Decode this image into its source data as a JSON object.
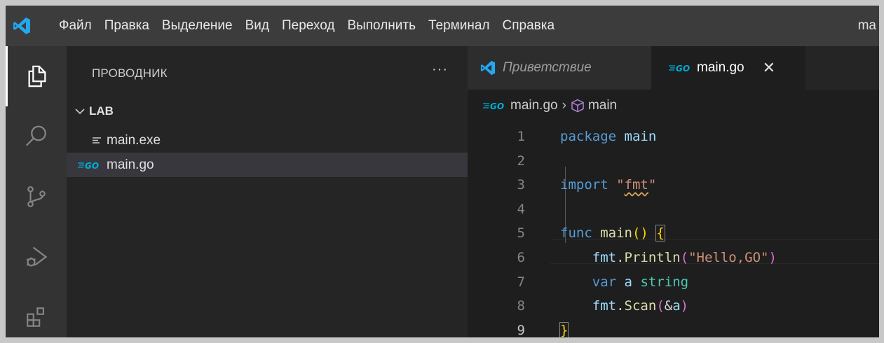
{
  "menubar": {
    "items": [
      "Файл",
      "Правка",
      "Выделение",
      "Вид",
      "Переход",
      "Выполнить",
      "Терминал",
      "Справка"
    ],
    "title_fragment": "ma"
  },
  "activity_bar": {
    "icons": [
      "explorer-icon",
      "search-icon",
      "source-control-icon",
      "run-debug-icon",
      "extensions-icon"
    ]
  },
  "sidebar": {
    "title": "ПРОВОДНИК",
    "more": "···",
    "folder": "LAB",
    "files": [
      {
        "name": "main.exe",
        "icon": "lines-icon"
      },
      {
        "name": "main.go",
        "icon": "go-icon",
        "selected": true
      }
    ]
  },
  "editor": {
    "tabs": [
      {
        "label": "Приветствие",
        "active": false,
        "icon": "vscode-icon"
      },
      {
        "label": "main.go",
        "active": true,
        "icon": "go-icon",
        "close": "✕"
      }
    ],
    "breadcrumb": {
      "file": "main.go",
      "separator": "›",
      "symbol": "main"
    },
    "lines": [
      {
        "n": "1",
        "tokens": [
          [
            "kw",
            "package"
          ],
          [
            "plain",
            " "
          ],
          [
            "var",
            "main"
          ]
        ]
      },
      {
        "n": "2",
        "tokens": []
      },
      {
        "n": "3",
        "tokens": [
          [
            "kw",
            "import"
          ],
          [
            "plain",
            " "
          ],
          [
            "str",
            "\""
          ],
          [
            "strsq",
            "fmt"
          ],
          [
            "str",
            "\""
          ]
        ]
      },
      {
        "n": "4",
        "tokens": []
      },
      {
        "n": "5",
        "tokens": [
          [
            "kw",
            "func"
          ],
          [
            "plain",
            " "
          ],
          [
            "fn",
            "main"
          ],
          [
            "br1",
            "()"
          ],
          [
            "plain",
            " "
          ],
          [
            "br1m",
            "{"
          ]
        ]
      },
      {
        "n": "6",
        "tokens": [
          [
            "plain",
            "    "
          ],
          [
            "var",
            "fmt"
          ],
          [
            "plain",
            "."
          ],
          [
            "fn",
            "Println"
          ],
          [
            "br2",
            "("
          ],
          [
            "str",
            "\"Hello,GO\""
          ],
          [
            "br2",
            ")"
          ]
        ]
      },
      {
        "n": "7",
        "tokens": [
          [
            "plain",
            "    "
          ],
          [
            "kw",
            "var"
          ],
          [
            "plain",
            " "
          ],
          [
            "var",
            "a"
          ],
          [
            "plain",
            " "
          ],
          [
            "ty",
            "string"
          ]
        ]
      },
      {
        "n": "8",
        "tokens": [
          [
            "plain",
            "    "
          ],
          [
            "var",
            "fmt"
          ],
          [
            "plain",
            "."
          ],
          [
            "fn",
            "Scan"
          ],
          [
            "br2",
            "("
          ],
          [
            "plain",
            "&"
          ],
          [
            "var",
            "a"
          ],
          [
            "br2",
            ")"
          ]
        ]
      },
      {
        "n": "9",
        "tokens": [
          [
            "br1m",
            "}"
          ]
        ]
      }
    ],
    "current_line": "9"
  },
  "colors": {
    "titlebar": "#3c3c3c",
    "activitybar": "#333333",
    "sidebar": "#252526",
    "editor": "#1e1e1e",
    "accent": "#0078d4",
    "go_blue": "#00add8"
  }
}
